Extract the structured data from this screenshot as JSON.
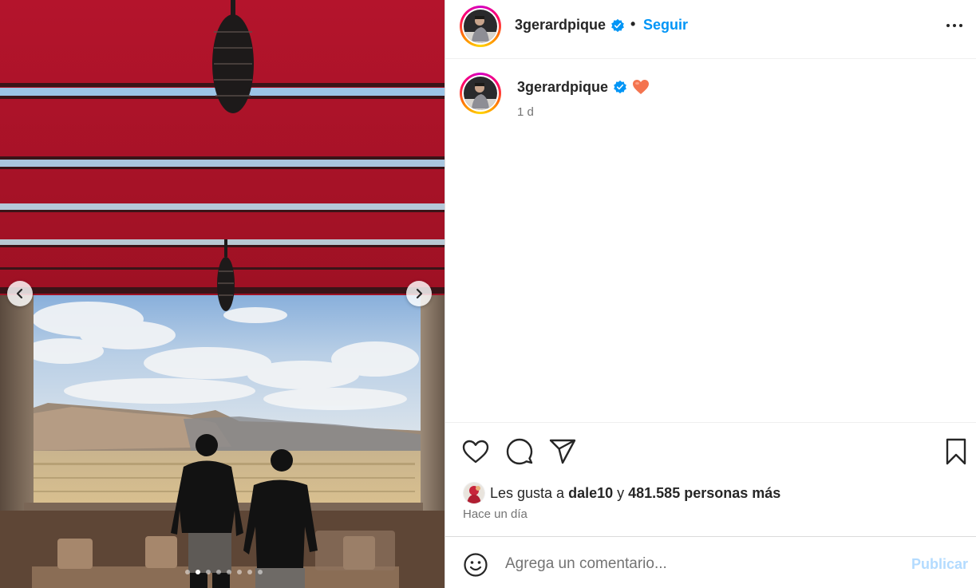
{
  "colors": {
    "accent": "#0095f6",
    "publish_disabled": "#b3dbff",
    "text": "#262626",
    "muted": "#737373",
    "verified": "#0095f6",
    "heart_emoji": "#f4744f"
  },
  "media": {
    "prev_icon": "chevron-left-icon",
    "next_icon": "chevron-right-icon",
    "slide_count": 8,
    "active_slide": 2
  },
  "header": {
    "username": "3gerardpique",
    "verified_icon": "verified-badge-icon",
    "separator": "•",
    "follow_label": "Seguir",
    "more_icon": "more-options-icon"
  },
  "caption": {
    "username": "3gerardpique",
    "verified_icon": "verified-badge-icon",
    "emoji": "orange-heart-icon",
    "time": "1 d"
  },
  "actions": {
    "like_icon": "heart-outline-icon",
    "comment_icon": "comment-bubble-icon",
    "share_icon": "paper-plane-icon",
    "save_icon": "bookmark-icon"
  },
  "likes": {
    "prefix": "Les gusta a ",
    "user": "dale10",
    "connector": " y ",
    "count": "481.585 personas más"
  },
  "posted": "Hace un día",
  "composer": {
    "emoji_icon": "smiley-icon",
    "placeholder": "Agrega un comentario...",
    "publish_label": "Publicar"
  }
}
